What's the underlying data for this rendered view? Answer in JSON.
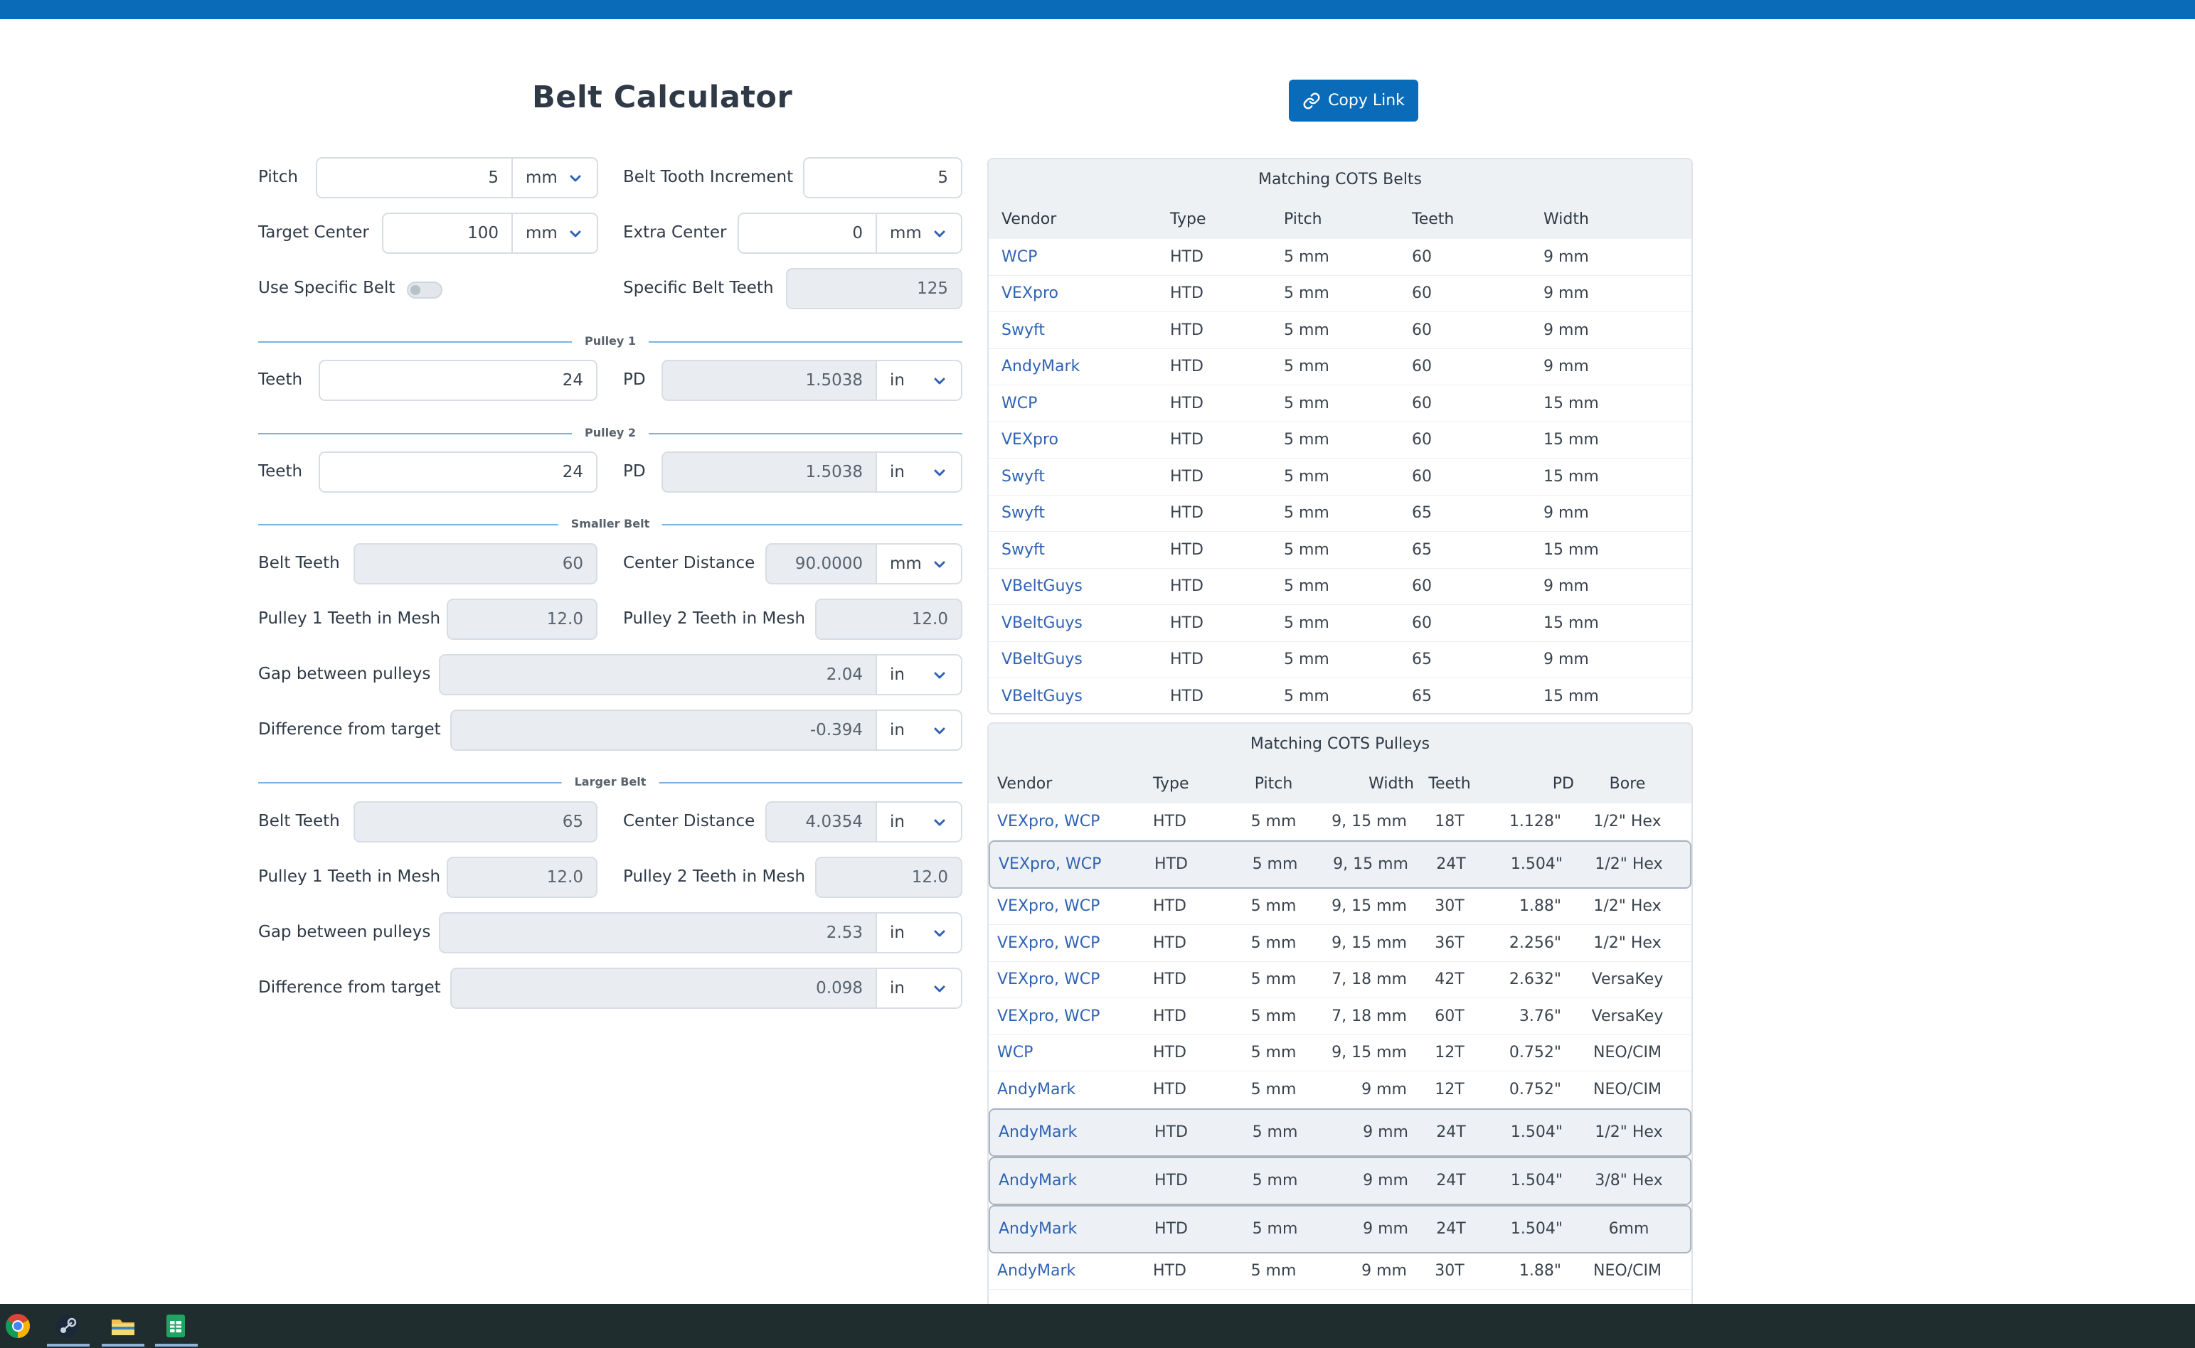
{
  "app": {
    "title": "Belt Calculator",
    "copy_link_label": "Copy Link"
  },
  "inputs": {
    "pitch": {
      "label": "Pitch",
      "value": "5",
      "unit": "mm"
    },
    "belt_tooth_increment": {
      "label": "Belt Tooth Increment",
      "value": "5"
    },
    "target_center": {
      "label": "Target Center",
      "value": "100",
      "unit": "mm"
    },
    "extra_center": {
      "label": "Extra Center",
      "value": "0",
      "unit": "mm"
    },
    "use_specific_belt": {
      "label": "Use Specific Belt",
      "enabled": false
    },
    "specific_belt_teeth": {
      "label": "Specific Belt Teeth",
      "value": "125"
    }
  },
  "pulley1": {
    "section": "Pulley 1",
    "teeth_label": "Teeth",
    "teeth": "24",
    "pd_label": "PD",
    "pd": "1.5038",
    "pd_unit": "in"
  },
  "pulley2": {
    "section": "Pulley 2",
    "teeth_label": "Teeth",
    "teeth": "24",
    "pd_label": "PD",
    "pd": "1.5038",
    "pd_unit": "in"
  },
  "smaller_belt": {
    "section": "Smaller Belt",
    "belt_teeth_label": "Belt Teeth",
    "belt_teeth": "60",
    "center_label": "Center Distance",
    "center": "90.0000",
    "center_unit": "mm",
    "p1_mesh_label": "Pulley 1 Teeth in Mesh",
    "p1_mesh": "12.0",
    "p2_mesh_label": "Pulley 2 Teeth in Mesh",
    "p2_mesh": "12.0",
    "gap_label": "Gap between pulleys",
    "gap": "2.04",
    "gap_unit": "in",
    "diff_label": "Difference from target",
    "diff": "-0.394",
    "diff_unit": "in"
  },
  "larger_belt": {
    "section": "Larger Belt",
    "belt_teeth_label": "Belt Teeth",
    "belt_teeth": "65",
    "center_label": "Center Distance",
    "center": "4.0354",
    "center_unit": "in",
    "p1_mesh_label": "Pulley 1 Teeth in Mesh",
    "p1_mesh": "12.0",
    "p2_mesh_label": "Pulley 2 Teeth in Mesh",
    "p2_mesh": "12.0",
    "gap_label": "Gap between pulleys",
    "gap": "2.53",
    "gap_unit": "in",
    "diff_label": "Difference from target",
    "diff": "0.098",
    "diff_unit": "in"
  },
  "belts_table": {
    "title": "Matching COTS Belts",
    "headers": [
      "Vendor",
      "Type",
      "Pitch",
      "Teeth",
      "Width"
    ],
    "rows": [
      [
        "WCP",
        "HTD",
        "5 mm",
        "60",
        "9 mm"
      ],
      [
        "VEXpro",
        "HTD",
        "5 mm",
        "60",
        "9 mm"
      ],
      [
        "Swyft",
        "HTD",
        "5 mm",
        "60",
        "9 mm"
      ],
      [
        "AndyMark",
        "HTD",
        "5 mm",
        "60",
        "9 mm"
      ],
      [
        "WCP",
        "HTD",
        "5 mm",
        "60",
        "15 mm"
      ],
      [
        "VEXpro",
        "HTD",
        "5 mm",
        "60",
        "15 mm"
      ],
      [
        "Swyft",
        "HTD",
        "5 mm",
        "60",
        "15 mm"
      ],
      [
        "Swyft",
        "HTD",
        "5 mm",
        "65",
        "9 mm"
      ],
      [
        "Swyft",
        "HTD",
        "5 mm",
        "65",
        "15 mm"
      ],
      [
        "VBeltGuys",
        "HTD",
        "5 mm",
        "60",
        "9 mm"
      ],
      [
        "VBeltGuys",
        "HTD",
        "5 mm",
        "60",
        "15 mm"
      ],
      [
        "VBeltGuys",
        "HTD",
        "5 mm",
        "65",
        "9 mm"
      ],
      [
        "VBeltGuys",
        "HTD",
        "5 mm",
        "65",
        "15 mm"
      ]
    ]
  },
  "pulleys_table": {
    "title": "Matching COTS Pulleys",
    "headers": [
      "Vendor",
      "Type",
      "Pitch",
      "Width",
      "Teeth",
      "PD",
      "Bore"
    ],
    "rows": [
      {
        "cells": [
          "VEXpro, WCP",
          "HTD",
          "5 mm",
          "9, 15 mm",
          "18T",
          "1.128\"",
          "1/2\" Hex"
        ],
        "highlight": false
      },
      {
        "cells": [
          "VEXpro, WCP",
          "HTD",
          "5 mm",
          "9, 15 mm",
          "24T",
          "1.504\"",
          "1/2\" Hex"
        ],
        "highlight": true
      },
      {
        "cells": [
          "VEXpro, WCP",
          "HTD",
          "5 mm",
          "9, 15 mm",
          "30T",
          "1.88\"",
          "1/2\" Hex"
        ],
        "highlight": false
      },
      {
        "cells": [
          "VEXpro, WCP",
          "HTD",
          "5 mm",
          "9, 15 mm",
          "36T",
          "2.256\"",
          "1/2\" Hex"
        ],
        "highlight": false
      },
      {
        "cells": [
          "VEXpro, WCP",
          "HTD",
          "5 mm",
          "7, 18 mm",
          "42T",
          "2.632\"",
          "VersaKey"
        ],
        "highlight": false
      },
      {
        "cells": [
          "VEXpro, WCP",
          "HTD",
          "5 mm",
          "7, 18 mm",
          "60T",
          "3.76\"",
          "VersaKey"
        ],
        "highlight": false
      },
      {
        "cells": [
          "WCP",
          "HTD",
          "5 mm",
          "9, 15 mm",
          "12T",
          "0.752\"",
          "NEO/CIM"
        ],
        "highlight": false
      },
      {
        "cells": [
          "AndyMark",
          "HTD",
          "5 mm",
          "9 mm",
          "12T",
          "0.752\"",
          "NEO/CIM"
        ],
        "highlight": false
      },
      {
        "cells": [
          "AndyMark",
          "HTD",
          "5 mm",
          "9 mm",
          "24T",
          "1.504\"",
          "1/2\" Hex"
        ],
        "highlight": true
      },
      {
        "cells": [
          "AndyMark",
          "HTD",
          "5 mm",
          "9 mm",
          "24T",
          "1.504\"",
          "3/8\" Hex"
        ],
        "highlight": true
      },
      {
        "cells": [
          "AndyMark",
          "HTD",
          "5 mm",
          "9 mm",
          "24T",
          "1.504\"",
          "6mm"
        ],
        "highlight": true
      },
      {
        "cells": [
          "AndyMark",
          "HTD",
          "5 mm",
          "9 mm",
          "30T",
          "1.88\"",
          "NEO/CIM"
        ],
        "highlight": false
      }
    ]
  },
  "taskbar": {
    "icons": [
      "chrome-icon",
      "steam-icon",
      "file-explorer-icon",
      "sheets-icon"
    ]
  },
  "colors": {
    "accent": "#0a6cb8",
    "link": "#2f63b3",
    "readonly_bg": "#e9edf1",
    "taskbar": "#202d2f"
  }
}
